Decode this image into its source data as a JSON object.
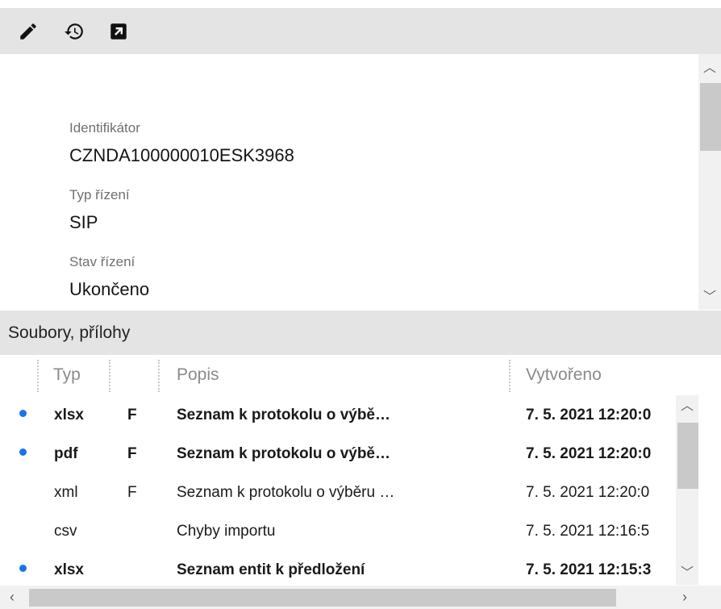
{
  "toolbar": {
    "icons": [
      "pencil-icon",
      "history-icon",
      "open-external-icon"
    ]
  },
  "detail": {
    "fields": [
      {
        "label": "Identifikátor",
        "value": "CZNDA100000010ESK3968"
      },
      {
        "label": "Typ řízení",
        "value": "SIP"
      },
      {
        "label": "Stav řízení",
        "value": "Ukončeno"
      }
    ]
  },
  "files": {
    "title": "Soubory, přílohy",
    "columns": [
      "Typ",
      "Popis",
      "Vytvořeno"
    ],
    "rows": [
      {
        "unread": true,
        "type": "xlsx",
        "flag": "F",
        "description": "Seznam k protokolu o výbě…",
        "created": "7. 5. 2021 12:20:0"
      },
      {
        "unread": true,
        "type": "pdf",
        "flag": "F",
        "description": "Seznam k protokolu o výbě…",
        "created": "7. 5. 2021 12:20:0"
      },
      {
        "unread": false,
        "type": "xml",
        "flag": "F",
        "description": "Seznam k protokolu o výběru …",
        "created": "7. 5. 2021 12:20:0"
      },
      {
        "unread": false,
        "type": "csv",
        "flag": "",
        "description": "Chyby importu",
        "created": "7. 5. 2021 12:16:5"
      },
      {
        "unread": true,
        "type": "xlsx",
        "flag": "",
        "description": "Seznam entit k předložení",
        "created": "7. 5. 2021 12:15:3"
      }
    ]
  },
  "colors": {
    "accent": "#1a73e8",
    "header_bg": "#e4e4e4"
  }
}
